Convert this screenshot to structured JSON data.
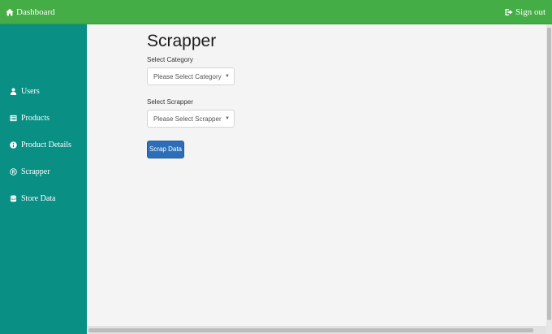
{
  "topbar": {
    "brand_label": "Dashboard",
    "signout_label": "Sign out"
  },
  "sidebar": {
    "items": [
      {
        "label": "Users",
        "icon": "user-icon"
      },
      {
        "label": "Products",
        "icon": "list-icon"
      },
      {
        "label": "Product Details",
        "icon": "info-circle-icon"
      },
      {
        "label": "Scrapper",
        "icon": "registered-icon"
      },
      {
        "label": "Store Data",
        "icon": "database-icon"
      }
    ]
  },
  "main": {
    "title": "Scrapper",
    "category": {
      "label": "Select Category",
      "selected": "Please Select Category"
    },
    "scrapper": {
      "label": "Select Scrapper",
      "selected": "Please Select Scrapper"
    },
    "submit_label": "Scrap Data"
  },
  "colors": {
    "topbar": "#45ad45",
    "sidebar": "#0a8f85",
    "primary_button": "#2c6fb8",
    "page_background": "#f4f4f4"
  }
}
